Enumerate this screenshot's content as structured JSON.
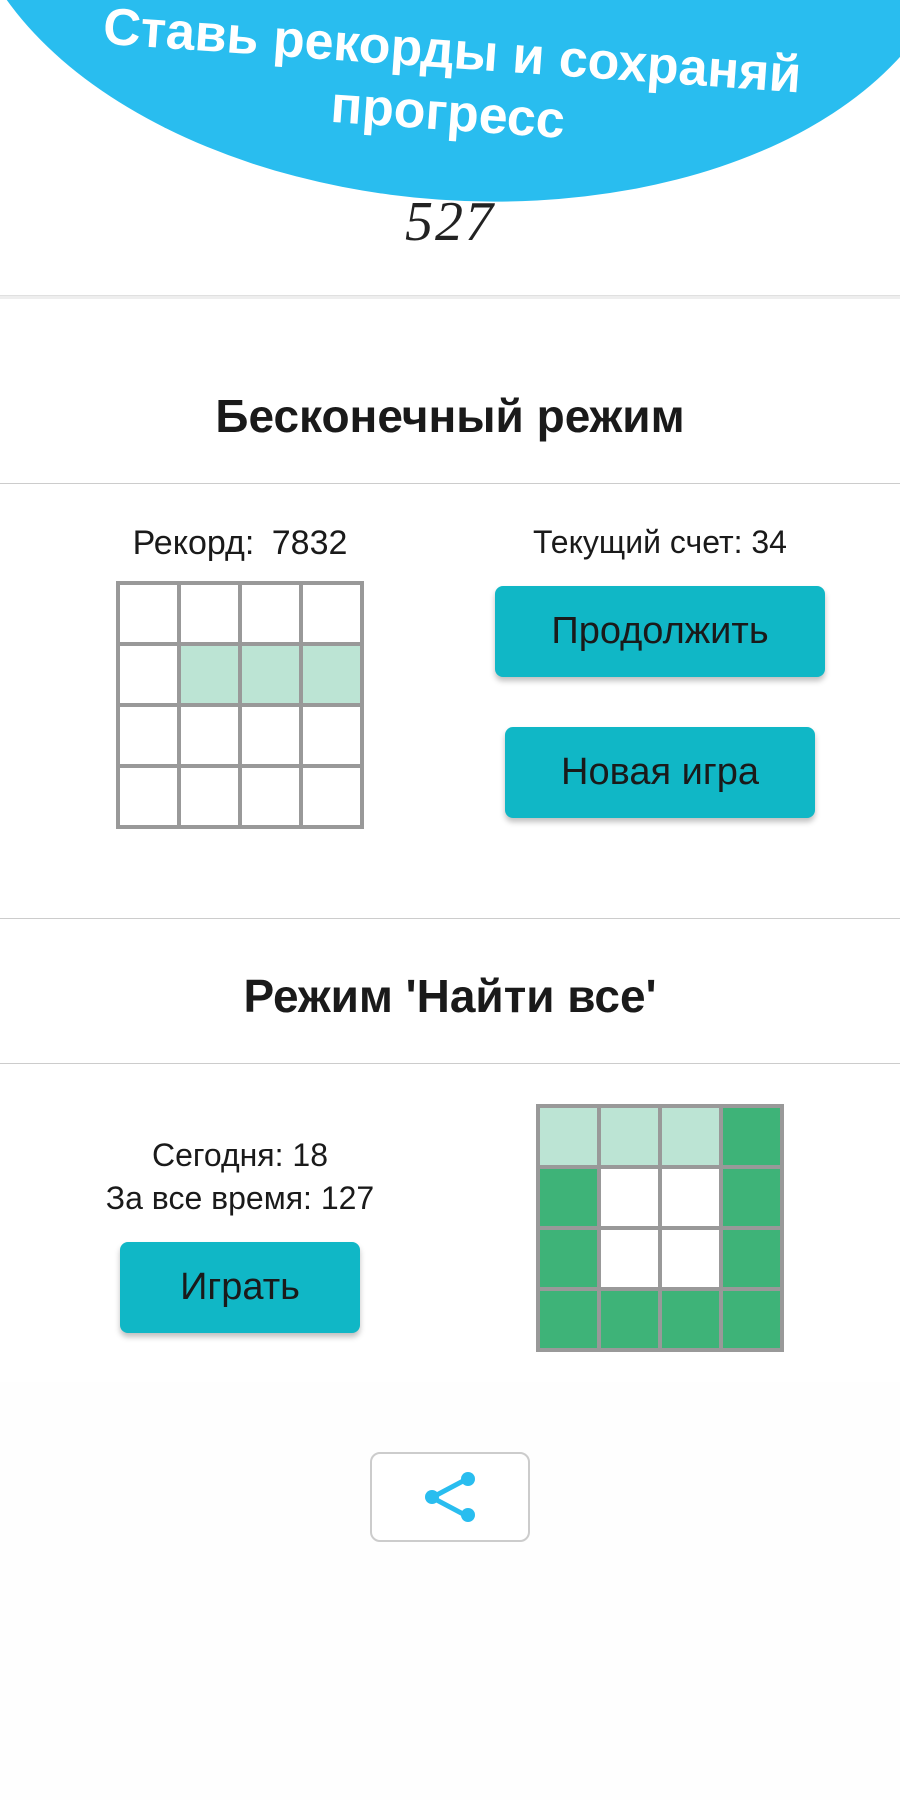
{
  "hero": {
    "title": "Ставь рекорды и сохраняй прогресс",
    "number": "527"
  },
  "endless": {
    "title": "Бесконечный режим",
    "record_label": "Рекорд:",
    "record_value": "7832",
    "current_label": "Текущий счет: 34",
    "continue_btn": "Продолжить",
    "newgame_btn": "Новая игра",
    "grid": [
      [
        0,
        0,
        0,
        0
      ],
      [
        0,
        1,
        1,
        1
      ],
      [
        0,
        0,
        0,
        0
      ],
      [
        0,
        0,
        0,
        0
      ]
    ]
  },
  "findall": {
    "title": "Режим 'Найти все'",
    "today_label": "Сегодня:",
    "today_value": "18",
    "alltime_label": "За все время:",
    "alltime_value": "127",
    "play_btn": "Играть",
    "grid": [
      [
        1,
        1,
        1,
        2
      ],
      [
        2,
        0,
        0,
        2
      ],
      [
        2,
        0,
        0,
        2
      ],
      [
        2,
        2,
        2,
        2
      ]
    ]
  },
  "icons": {
    "share": "share-icon"
  },
  "colors": {
    "accent": "#29bdef",
    "button": "#10b7c6",
    "cell_light": "#bce4d4",
    "cell_green": "#3eb378"
  }
}
